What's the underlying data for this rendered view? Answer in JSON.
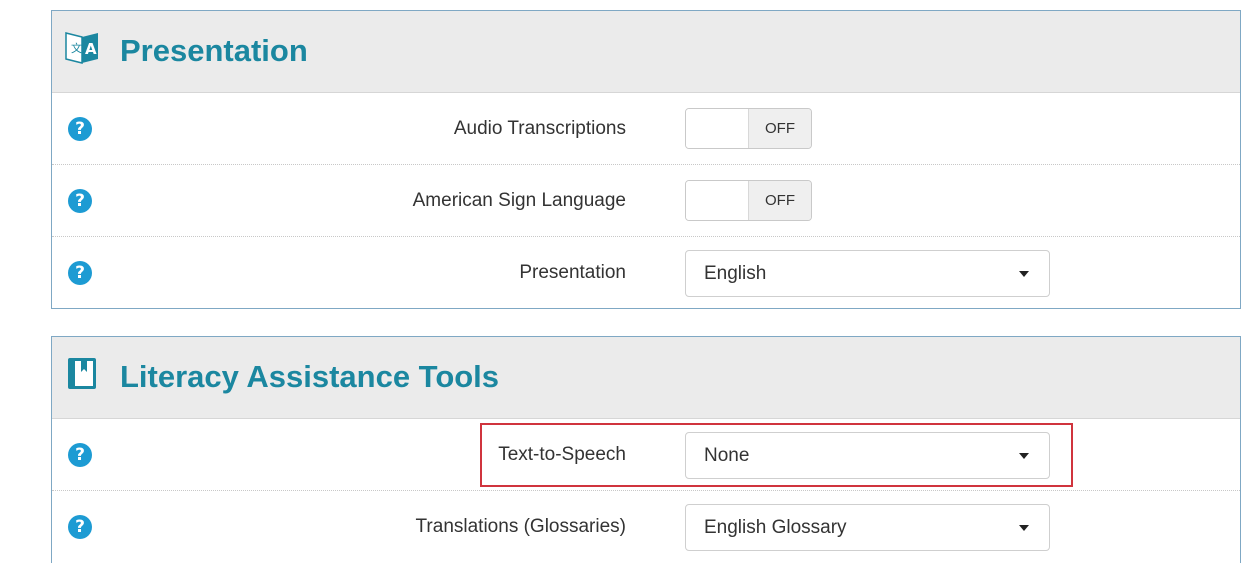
{
  "presentation_panel": {
    "title": "Presentation",
    "icon": "translate-icon",
    "rows": [
      {
        "label": "Audio Transcriptions",
        "control": "toggle",
        "state": "OFF"
      },
      {
        "label": "American Sign Language",
        "control": "toggle",
        "state": "OFF"
      },
      {
        "label": "Presentation",
        "control": "select",
        "value": "English"
      }
    ]
  },
  "literacy_panel": {
    "title": "Literacy Assistance Tools",
    "icon": "book-icon",
    "rows": [
      {
        "label": "Text-to-Speech",
        "control": "select",
        "value": "None"
      },
      {
        "label": "Translations (Glossaries)",
        "control": "select",
        "value": "English Glossary"
      }
    ]
  },
  "help_icon_glyph": "?",
  "colors": {
    "title": "#1b87a0",
    "help": "#1d9bd3",
    "header_bg": "#ebebeb",
    "panel_border": "#7fa8c4",
    "highlight": "#d0343d"
  }
}
